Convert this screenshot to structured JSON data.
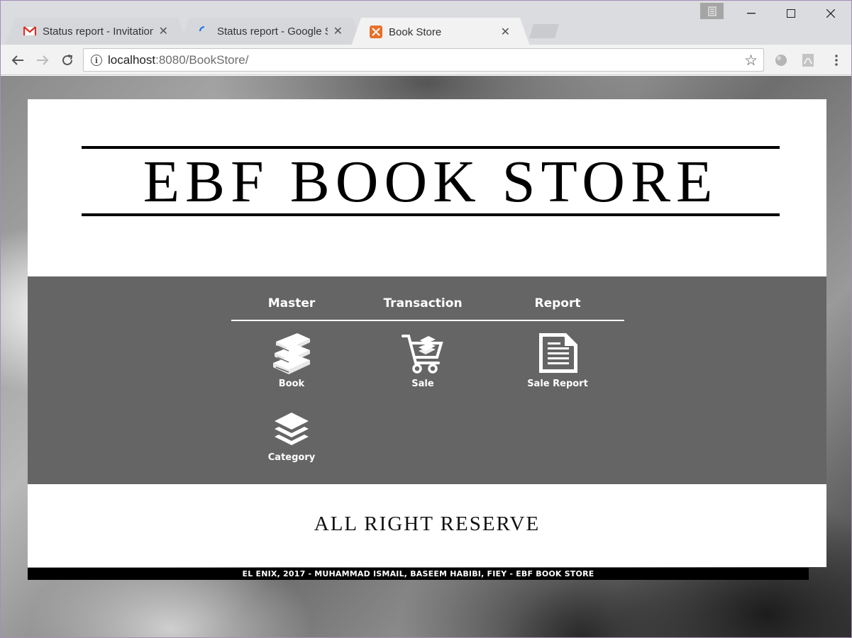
{
  "browser": {
    "tabs": [
      {
        "title": "Status report - Invitation",
        "icon": "gmail-icon"
      },
      {
        "title": "Status report - Google Sl",
        "icon": "loading-spinner-icon"
      },
      {
        "title": "Book Store",
        "icon": "xampp-icon",
        "active": true
      }
    ],
    "tab_close": "✕",
    "window_controls": {
      "minimize": "—",
      "maximize": "☐",
      "close": "✕"
    },
    "url": {
      "host": "localhost",
      "path": ":8080/BookStore/"
    }
  },
  "page": {
    "logo_text": "EBF BOOK STORE",
    "menu": {
      "headers": [
        "Master",
        "Transaction",
        "Report"
      ],
      "items": [
        {
          "label": "Book",
          "icon": "books-icon"
        },
        {
          "label": "Sale",
          "icon": "shopping-cart-icon"
        },
        {
          "label": "Sale Report",
          "icon": "document-icon"
        },
        {
          "label": "Category",
          "icon": "layers-icon"
        }
      ]
    },
    "footer_text": "ALL RIGHT RESERVE",
    "credit": "El Enix, 2017 - Muhammad Ismail, Baseem Habibi, Fiey - EBF Book Store"
  },
  "colors": {
    "menu_panel": "#656565",
    "tab_active": "#f2f2f2",
    "titlebar": "#dadce0"
  }
}
